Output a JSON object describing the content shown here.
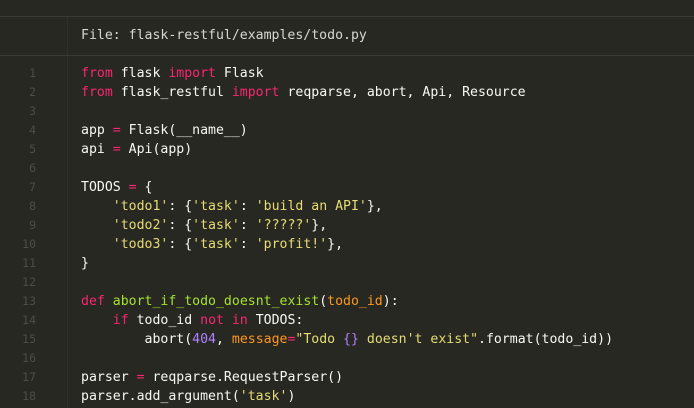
{
  "file": {
    "label": "File: flask-restful/examples/todo.py"
  },
  "lines": [
    {
      "n": "1",
      "tokens": [
        {
          "t": "from",
          "c": "kw"
        },
        {
          "t": " flask ",
          "c": ""
        },
        {
          "t": "import",
          "c": "kw"
        },
        {
          "t": " Flask",
          "c": ""
        }
      ]
    },
    {
      "n": "2",
      "tokens": [
        {
          "t": "from",
          "c": "kw"
        },
        {
          "t": " flask_restful ",
          "c": ""
        },
        {
          "t": "import",
          "c": "kw"
        },
        {
          "t": " reqparse, abort, Api, Resource",
          "c": ""
        }
      ]
    },
    {
      "n": "3",
      "tokens": []
    },
    {
      "n": "4",
      "tokens": [
        {
          "t": "app ",
          "c": ""
        },
        {
          "t": "=",
          "c": "op"
        },
        {
          "t": " Flask(__name__)",
          "c": ""
        }
      ]
    },
    {
      "n": "5",
      "tokens": [
        {
          "t": "api ",
          "c": ""
        },
        {
          "t": "=",
          "c": "op"
        },
        {
          "t": " Api(app)",
          "c": ""
        }
      ]
    },
    {
      "n": "6",
      "tokens": []
    },
    {
      "n": "7",
      "tokens": [
        {
          "t": "TODOS ",
          "c": ""
        },
        {
          "t": "=",
          "c": "op"
        },
        {
          "t": " {",
          "c": ""
        }
      ]
    },
    {
      "n": "8",
      "tokens": [
        {
          "t": "    ",
          "c": ""
        },
        {
          "t": "'todo1'",
          "c": "str"
        },
        {
          "t": ": {",
          "c": ""
        },
        {
          "t": "'task'",
          "c": "str"
        },
        {
          "t": ": ",
          "c": ""
        },
        {
          "t": "'build an API'",
          "c": "str"
        },
        {
          "t": "},",
          "c": ""
        }
      ]
    },
    {
      "n": "9",
      "tokens": [
        {
          "t": "    ",
          "c": ""
        },
        {
          "t": "'todo2'",
          "c": "str"
        },
        {
          "t": ": {",
          "c": ""
        },
        {
          "t": "'task'",
          "c": "str"
        },
        {
          "t": ": ",
          "c": ""
        },
        {
          "t": "'?????'",
          "c": "str"
        },
        {
          "t": "},",
          "c": ""
        }
      ]
    },
    {
      "n": "10",
      "tokens": [
        {
          "t": "    ",
          "c": ""
        },
        {
          "t": "'todo3'",
          "c": "str"
        },
        {
          "t": ": {",
          "c": ""
        },
        {
          "t": "'task'",
          "c": "str"
        },
        {
          "t": ": ",
          "c": ""
        },
        {
          "t": "'profit!'",
          "c": "str"
        },
        {
          "t": "},",
          "c": ""
        }
      ]
    },
    {
      "n": "11",
      "tokens": [
        {
          "t": "}",
          "c": ""
        }
      ]
    },
    {
      "n": "12",
      "tokens": []
    },
    {
      "n": "13",
      "tokens": [
        {
          "t": "def",
          "c": "kw"
        },
        {
          "t": " ",
          "c": ""
        },
        {
          "t": "abort_if_todo_doesnt_exist",
          "c": "fn"
        },
        {
          "t": "(",
          "c": ""
        },
        {
          "t": "todo_id",
          "c": "arg"
        },
        {
          "t": "):",
          "c": ""
        }
      ]
    },
    {
      "n": "14",
      "tokens": [
        {
          "t": "    ",
          "c": ""
        },
        {
          "t": "if",
          "c": "kw"
        },
        {
          "t": " todo_id ",
          "c": ""
        },
        {
          "t": "not",
          "c": "kw"
        },
        {
          "t": " ",
          "c": ""
        },
        {
          "t": "in",
          "c": "kw"
        },
        {
          "t": " TODOS:",
          "c": ""
        }
      ]
    },
    {
      "n": "15",
      "tokens": [
        {
          "t": "        abort(",
          "c": ""
        },
        {
          "t": "404",
          "c": "num"
        },
        {
          "t": ", ",
          "c": ""
        },
        {
          "t": "message",
          "c": "arg"
        },
        {
          "t": "=",
          "c": "op"
        },
        {
          "t": "\"Todo ",
          "c": "str"
        },
        {
          "t": "{}",
          "c": "num"
        },
        {
          "t": " doesn't exist\"",
          "c": "str"
        },
        {
          "t": ".format(todo_id))",
          "c": ""
        }
      ]
    },
    {
      "n": "16",
      "tokens": []
    },
    {
      "n": "17",
      "tokens": [
        {
          "t": "parser ",
          "c": ""
        },
        {
          "t": "=",
          "c": "op"
        },
        {
          "t": " reqparse.RequestParser()",
          "c": ""
        }
      ]
    },
    {
      "n": "18",
      "tokens": [
        {
          "t": "parser.add_argument(",
          "c": ""
        },
        {
          "t": "'task'",
          "c": "str"
        },
        {
          "t": ")",
          "c": ""
        }
      ]
    }
  ],
  "colors": {
    "background": "#272822",
    "keyword": "#f92672",
    "function": "#a6e22e",
    "string": "#e6db74",
    "number": "#ae81ff",
    "argument": "#fd971f",
    "line_number": "#4c4d46"
  }
}
